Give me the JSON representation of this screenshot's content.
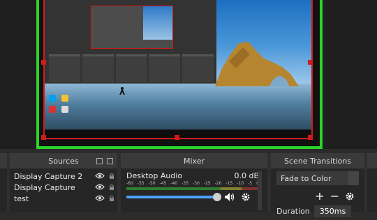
{
  "preview": {
    "mini_labels": []
  },
  "panels": {
    "sources": {
      "title": "Sources",
      "items": [
        {
          "label": "Display Capture 2"
        },
        {
          "label": "Display Capture"
        },
        {
          "label": "test"
        }
      ]
    },
    "mixer": {
      "title": "Mixer",
      "channel_name": "Desktop Audio",
      "channel_level": "0.0 dB",
      "ticks": [
        "-60",
        "-55",
        "-50",
        "-45",
        "-40",
        "-35",
        "-30",
        "-25",
        "-20",
        "-15",
        "-10",
        "-5",
        "0"
      ],
      "volume_fraction": 1.0
    },
    "transitions": {
      "title": "Scene Transitions",
      "selected": "Fade to Color",
      "add": "+",
      "remove": "−",
      "duration_label": "Duration",
      "duration_value": "350ms"
    }
  },
  "colors": {
    "selection": "#29d52b",
    "bounds": "#d21a1a",
    "accent": "#4fa3ff"
  }
}
